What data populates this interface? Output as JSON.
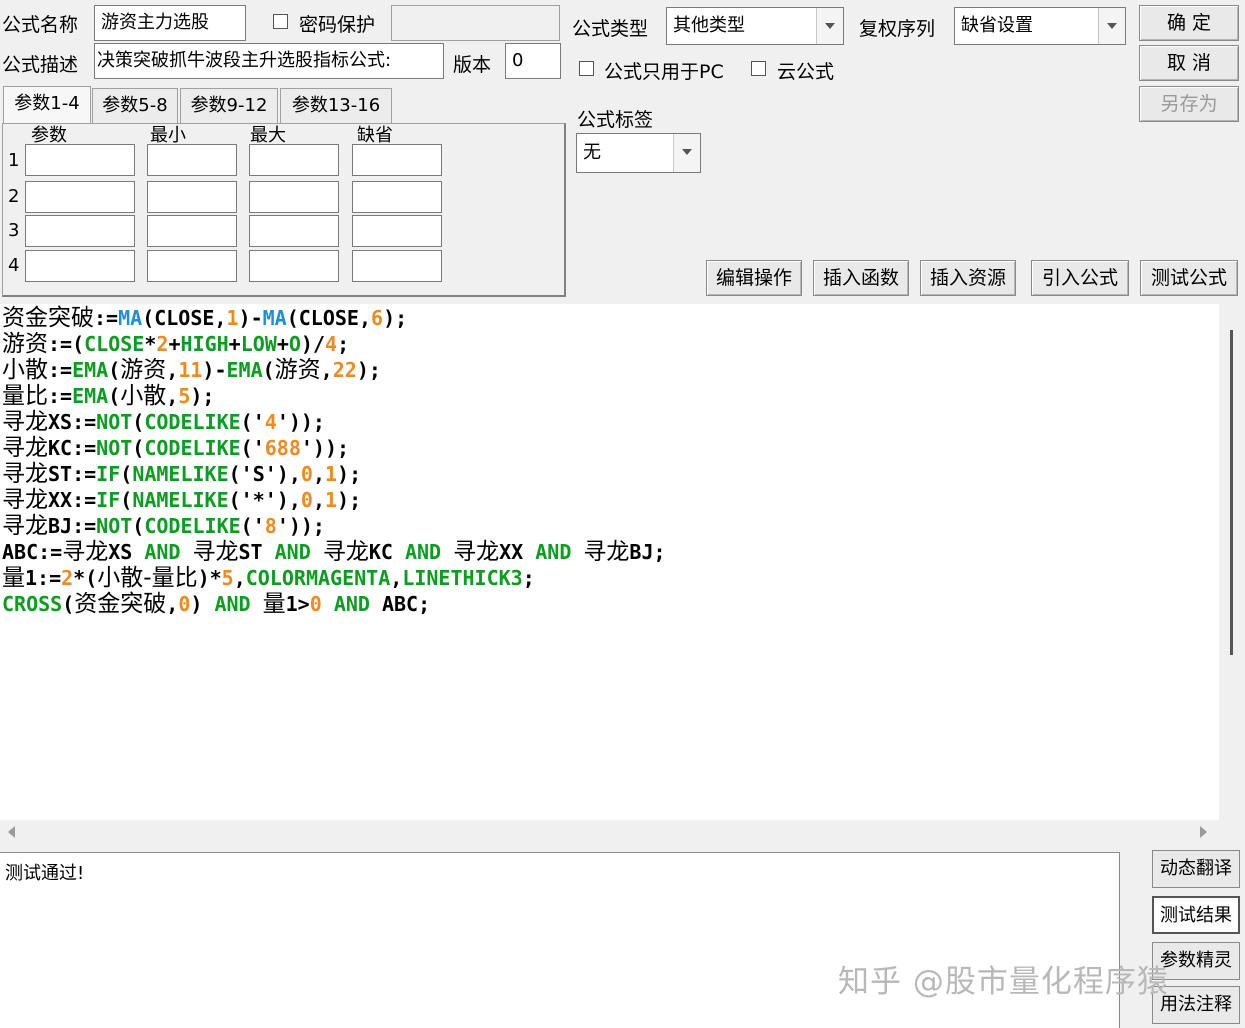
{
  "header": {
    "name_label": "公式名称",
    "name_value": "游资主力选股",
    "password_label": "密码保护",
    "type_label": "公式类型",
    "type_value": "其他类型",
    "rights_label": "复权序列",
    "rights_value": "缺省设置",
    "desc_label": "公式描述",
    "desc_value": "决策突破抓牛波段主升选股指标公式:",
    "version_label": "版本",
    "version_value": "0",
    "pc_only_label": "公式只用于PC",
    "cloud_label": "云公式",
    "tag_label": "公式标签",
    "tag_value": "无"
  },
  "buttons": {
    "ok": "确 定",
    "cancel": "取 消",
    "save_as": "另存为",
    "edit_ops": "编辑操作",
    "insert_func": "插入函数",
    "insert_res": "插入资源",
    "import_formula": "引入公式",
    "test_formula": "测试公式"
  },
  "tabs": [
    "参数1-4",
    "参数5-8",
    "参数9-12",
    "参数13-16"
  ],
  "params": {
    "headers": [
      "参数",
      "最小",
      "最大",
      "缺省"
    ],
    "rows": [
      "1",
      "2",
      "3",
      "4"
    ]
  },
  "code": [
    [
      [
        "cn",
        "资金突破"
      ],
      [
        "k",
        ":="
      ],
      [
        "b",
        "MA"
      ],
      [
        "k",
        "(CLOSE,"
      ],
      [
        "o",
        "1"
      ],
      [
        "k",
        ")-"
      ],
      [
        "b",
        "MA"
      ],
      [
        "k",
        "(CLOSE,"
      ],
      [
        "o",
        "6"
      ],
      [
        "k",
        ");"
      ]
    ],
    [
      [
        "cn",
        "游资"
      ],
      [
        "k",
        ":=("
      ],
      [
        "g",
        "CLOSE"
      ],
      [
        "k",
        "*"
      ],
      [
        "o",
        "2"
      ],
      [
        "k",
        "+"
      ],
      [
        "g",
        "HIGH"
      ],
      [
        "k",
        "+"
      ],
      [
        "g",
        "LOW"
      ],
      [
        "k",
        "+"
      ],
      [
        "g",
        "O"
      ],
      [
        "k",
        ")/"
      ],
      [
        "o",
        "4"
      ],
      [
        "k",
        ";"
      ]
    ],
    [
      [
        "cn",
        "小散"
      ],
      [
        "k",
        ":="
      ],
      [
        "g",
        "EMA"
      ],
      [
        "k",
        "("
      ],
      [
        "cn",
        "游资"
      ],
      [
        "k",
        ","
      ],
      [
        "o",
        "11"
      ],
      [
        "k",
        ")-"
      ],
      [
        "g",
        "EMA"
      ],
      [
        "k",
        "("
      ],
      [
        "cn",
        "游资"
      ],
      [
        "k",
        ","
      ],
      [
        "o",
        "22"
      ],
      [
        "k",
        ");"
      ]
    ],
    [
      [
        "cn",
        "量比"
      ],
      [
        "k",
        ":="
      ],
      [
        "g",
        "EMA"
      ],
      [
        "k",
        "("
      ],
      [
        "cn",
        "小散"
      ],
      [
        "k",
        ","
      ],
      [
        "o",
        "5"
      ],
      [
        "k",
        ");"
      ]
    ],
    [
      [
        "cn",
        "寻龙"
      ],
      [
        "k",
        "XS:="
      ],
      [
        "g",
        "NOT"
      ],
      [
        "k",
        "("
      ],
      [
        "g",
        "CODELIKE"
      ],
      [
        "k",
        "('"
      ],
      [
        "o",
        "4"
      ],
      [
        "k",
        "'));"
      ]
    ],
    [
      [
        "cn",
        "寻龙"
      ],
      [
        "k",
        "KC:="
      ],
      [
        "g",
        "NOT"
      ],
      [
        "k",
        "("
      ],
      [
        "g",
        "CODELIKE"
      ],
      [
        "k",
        "('"
      ],
      [
        "o",
        "688"
      ],
      [
        "k",
        "'));"
      ]
    ],
    [
      [
        "cn",
        "寻龙"
      ],
      [
        "k",
        "ST:="
      ],
      [
        "g",
        "IF"
      ],
      [
        "k",
        "("
      ],
      [
        "g",
        "NAMELIKE"
      ],
      [
        "k",
        "('S'),"
      ],
      [
        "o",
        "0"
      ],
      [
        "k",
        ","
      ],
      [
        "o",
        "1"
      ],
      [
        "k",
        ");"
      ]
    ],
    [
      [
        "cn",
        "寻龙"
      ],
      [
        "k",
        "XX:="
      ],
      [
        "g",
        "IF"
      ],
      [
        "k",
        "("
      ],
      [
        "g",
        "NAMELIKE"
      ],
      [
        "k",
        "('*'),"
      ],
      [
        "o",
        "0"
      ],
      [
        "k",
        ","
      ],
      [
        "o",
        "1"
      ],
      [
        "k",
        ");"
      ]
    ],
    [
      [
        "cn",
        "寻龙"
      ],
      [
        "k",
        "BJ:="
      ],
      [
        "g",
        "NOT"
      ],
      [
        "k",
        "("
      ],
      [
        "g",
        "CODELIKE"
      ],
      [
        "k",
        "('"
      ],
      [
        "o",
        "8"
      ],
      [
        "k",
        "'));"
      ]
    ],
    [
      [
        "k",
        "ABC:="
      ],
      [
        "cn",
        "寻龙"
      ],
      [
        "k",
        "XS "
      ],
      [
        "g",
        "AND"
      ],
      [
        "k",
        " "
      ],
      [
        "cn",
        "寻龙"
      ],
      [
        "k",
        "ST "
      ],
      [
        "g",
        "AND"
      ],
      [
        "k",
        " "
      ],
      [
        "cn",
        "寻龙"
      ],
      [
        "k",
        "KC "
      ],
      [
        "g",
        "AND"
      ],
      [
        "k",
        " "
      ],
      [
        "cn",
        "寻龙"
      ],
      [
        "k",
        "XX "
      ],
      [
        "g",
        "AND"
      ],
      [
        "k",
        " "
      ],
      [
        "cn",
        "寻龙"
      ],
      [
        "k",
        "BJ;"
      ]
    ],
    [
      [
        "cn",
        "量"
      ],
      [
        "k",
        "1:="
      ],
      [
        "o",
        "2"
      ],
      [
        "k",
        "*("
      ],
      [
        "cn",
        "小散-量比"
      ],
      [
        "k",
        ")*"
      ],
      [
        "o",
        "5"
      ],
      [
        "k",
        ","
      ],
      [
        "g",
        "COLORMAGENTA"
      ],
      [
        "k",
        ","
      ],
      [
        "g",
        "LINETHICK3"
      ],
      [
        "k",
        ";"
      ]
    ],
    [
      [
        "g",
        "CROSS"
      ],
      [
        "k",
        "("
      ],
      [
        "cn",
        "资金突破"
      ],
      [
        "k",
        ","
      ],
      [
        "o",
        "0"
      ],
      [
        "k",
        ") "
      ],
      [
        "g",
        "AND"
      ],
      [
        "k",
        " "
      ],
      [
        "cn",
        "量"
      ],
      [
        "k",
        "1>"
      ],
      [
        "o",
        "0"
      ],
      [
        "k",
        " "
      ],
      [
        "g",
        "AND"
      ],
      [
        "k",
        " ABC;"
      ]
    ]
  ],
  "output": {
    "message": "测试通过!"
  },
  "side_buttons": [
    "动态翻译",
    "测试结果",
    "参数精灵",
    "用法注释"
  ],
  "watermark": "知乎 @股市量化程序猿"
}
